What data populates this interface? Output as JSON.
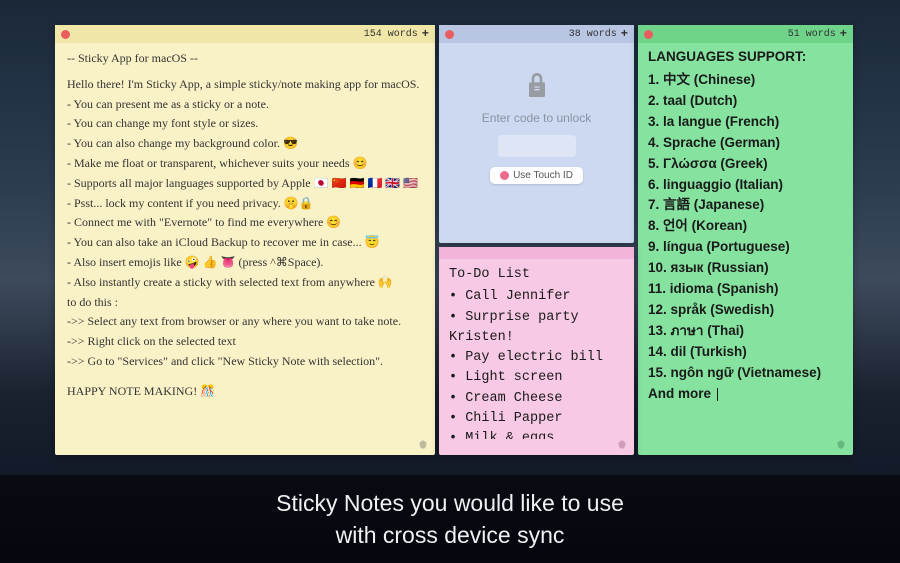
{
  "note1": {
    "word_count": "154 words",
    "title": "-- Sticky App for macOS --",
    "intro": "Hello there! I'm Sticky App, a simple sticky/note making app for macOS.",
    "bullets": [
      "- You can present me as a sticky or a note.",
      "- You can change my font style or sizes.",
      "- You can also change my background color. 😎",
      "- Make me float or transparent, whichever suits your needs 😊",
      "- Supports all major languages supported by Apple 🇯🇵 🇨🇳 🇩🇪 🇫🇷 🇬🇧 🇺🇸",
      "- Psst... lock my content if you need privacy. 🤫🔒",
      "- Connect me with \"Evernote\" to find me everywhere 😊",
      "- You can also take an iCloud Backup to recover me in case... 😇",
      "- Also insert emojis like 🤪 👍 👅 (press ^⌘Space).",
      "- Also instantly create a sticky with selected text from anywhere 🙌"
    ],
    "howto_label": "to do this :",
    "howto": [
      "->> Select any text from browser or any where you want to take note.",
      "->> Right click on the selected text",
      "->> Go to \"Services\" and click \"New Sticky Note with selection\"."
    ],
    "happy": "HAPPY NOTE MAKING! 🎊"
  },
  "note2": {
    "word_count": "38 words",
    "lock_placeholder": "Enter code to unlock",
    "touch_id": "Use Touch ID"
  },
  "note3": {
    "word_count": "51 words",
    "title": "LANGUAGES SUPPORT:",
    "items": [
      "中文 (Chinese)",
      "taal (Dutch)",
      "la langue (French)",
      "Sprache (German)",
      "Γλώσσα (Greek)",
      "linguaggio (Italian)",
      "言語 (Japanese)",
      "언어 (Korean)",
      "língua (Portuguese)",
      "язык (Russian)",
      "idioma (Spanish)",
      "språk (Swedish)",
      "ภาษา (Thai)",
      "dil (Turkish)",
      "ngôn ngữ (Vietnamese)"
    ],
    "more": "And more"
  },
  "note4": {
    "title": "To-Do List",
    "items": [
      "Call Jennifer",
      "Surprise party Kristen!",
      "Pay electric bill",
      "Light screen",
      "Cream Cheese",
      "Chili Papper",
      "Milk & eggs"
    ]
  },
  "caption": {
    "line1": "Sticky Notes you would like to use",
    "line2": "with cross device sync"
  }
}
